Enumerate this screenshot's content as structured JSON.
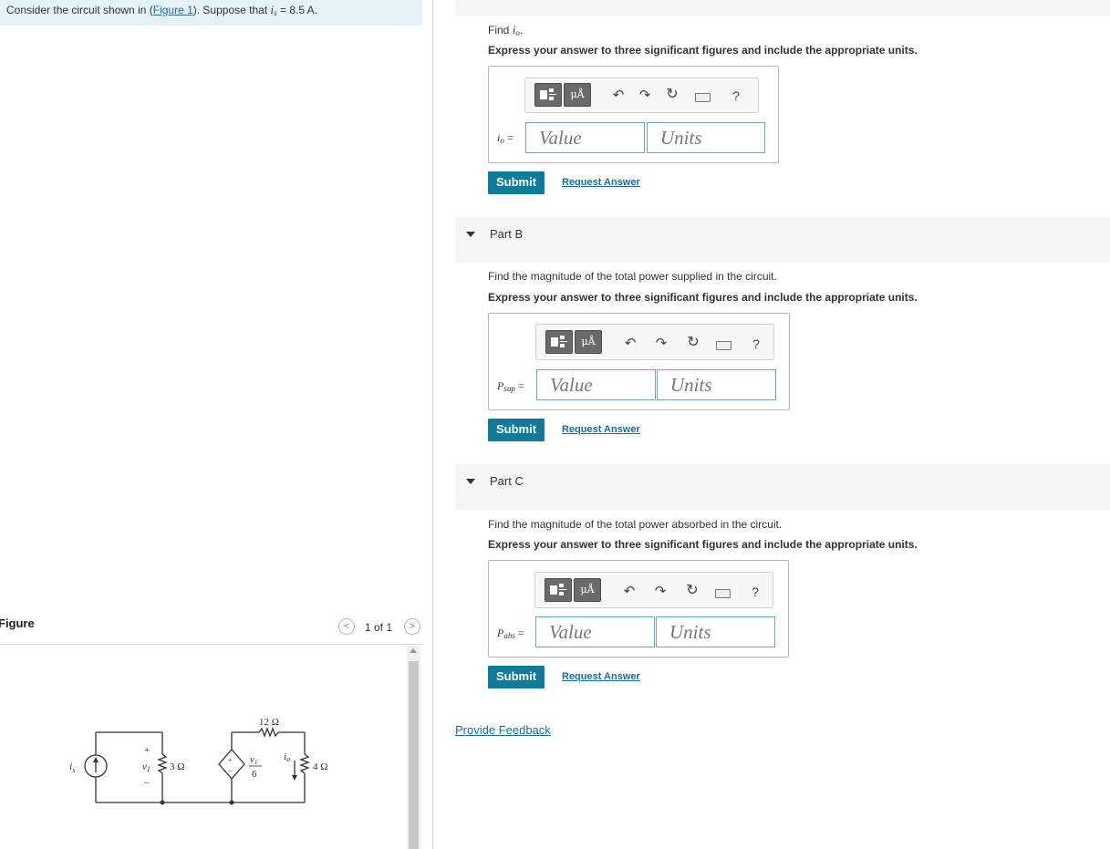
{
  "problem": {
    "intro_prefix": "Consider the circuit shown in (",
    "figure_link": "Figure 1",
    "intro_suffix": "). Suppose that",
    "is_symbol": "i",
    "is_sub": "s",
    "is_value": "= 8.5 A."
  },
  "partA": {
    "question_prefix": "Find",
    "var": "i",
    "var_sub": "o",
    "period": ".",
    "instruction": "Express your answer to three significant figures and include the appropriate units.",
    "label": "i",
    "label_sub": "o",
    "label_eq": " =",
    "value_placeholder": "Value",
    "units_placeholder": "Units",
    "submit": "Submit",
    "request": "Request Answer"
  },
  "partB": {
    "title": "Part B",
    "question": "Find the magnitude of the total power supplied in the circuit.",
    "instruction": "Express your answer to three significant figures and include the appropriate units.",
    "label": "P",
    "label_sub": "sup",
    "label_eq": " =",
    "value_placeholder": "Value",
    "units_placeholder": "Units",
    "submit": "Submit",
    "request": "Request Answer"
  },
  "partC": {
    "title": "Part C",
    "question": "Find the magnitude of the total power absorbed in the circuit.",
    "instruction": "Express your answer to three significant figures and include the appropriate units.",
    "label": "P",
    "label_sub": "abs",
    "label_eq": " =",
    "value_placeholder": "Value",
    "units_placeholder": "Units",
    "submit": "Submit",
    "request": "Request Answer"
  },
  "toolbar": {
    "mu_label": "μÅ",
    "help": "?"
  },
  "feedback": "Provide Feedback",
  "figure": {
    "header": "Figure",
    "pager": "1 of 1",
    "prev": "<",
    "next": ">",
    "labels": {
      "is": "i",
      "is_sub": "s",
      "plus": "+",
      "minus": "−",
      "v1": "v",
      "v1_sub": "1",
      "r3": "3 Ω",
      "r12": "12 Ω",
      "r4": "4 Ω",
      "frac_num_v": "v",
      "frac_num_sub": "1",
      "frac_den": "6",
      "io": "i",
      "io_sub": "o",
      "dep_plus": "+",
      "dep_minus": "−"
    }
  }
}
